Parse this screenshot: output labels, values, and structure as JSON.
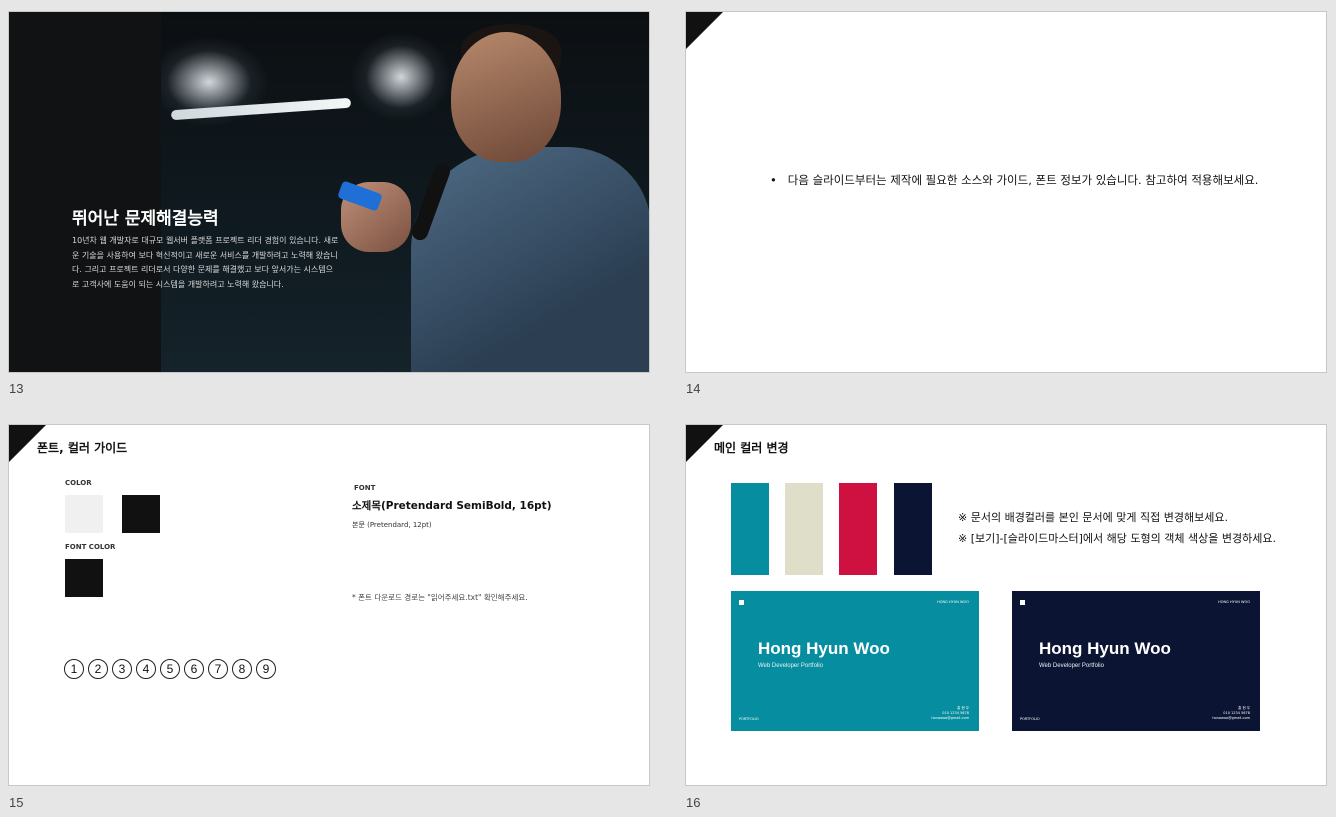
{
  "slides": [
    {
      "number": "13",
      "title": "뛰어난 문제해결능력",
      "body": "10년차 웹 개발자로 대규모 웹서버 플랫폼 프로젝트 리더 경험이 있습니다. 새로운 기술을 사용하여 보다 혁신적이고 새로운 서비스를 개발하려고 노력해 왔습니다. 그리고 프로젝트 리더로서 다양한 문제를 해결했고 보다 앞서가는 시스템으로 고객사에 도움이 되는 시스템을 개발하려고 노력해 왔습니다."
    },
    {
      "number": "14",
      "bullet": "다음 슬라이드부터는 제작에  필요한 소스와 가이드, 폰트 정보가 있습니다. 참고하여 적용해보세요."
    },
    {
      "number": "15",
      "title": "폰트, 컬러 가이드",
      "color_label": "COLOR",
      "font_color_label": "FONT COLOR",
      "font_label": "FONT",
      "font_title": "소제목(Pretendard SemiBold, 16pt)",
      "font_body": "본문 (Pretendard, 12pt)",
      "font_note": "* 폰트 다운로드 경로는 \"읽어주세요.txt\" 확인해주세요.",
      "colors": [
        "#f0f0f0",
        "#111111"
      ],
      "font_colors": [
        "#111111"
      ],
      "numbers": [
        "1",
        "2",
        "3",
        "4",
        "5",
        "6",
        "7",
        "8",
        "9"
      ]
    },
    {
      "number": "16",
      "title": "메인 컬러 변경",
      "palette": [
        "#078da0",
        "#dfdfc9",
        "#cf1142",
        "#0b1433"
      ],
      "note1": "※ 문서의 배경컬러를 본인 문서에 맞게 직접 변경해보세요.",
      "note2": "※ [보기]-[슬라이드마스터]에서 해당 도형의 객체 색상을 변경하세요.",
      "cards": [
        {
          "color": "#078da0",
          "name": "Hong Hyun Woo",
          "subtitle": "Web Developer Portfolio",
          "top_label": "HONG HYUN WOO",
          "footer_left": "PORTFOLIO",
          "footer_right_1": "홍 현 우",
          "footer_right_2": "010 1234 5678",
          "footer_right_3": "honawoo@gmail.com"
        },
        {
          "color": "#0b1433",
          "name": "Hong Hyun Woo",
          "subtitle": "Web Developer Portfolio",
          "top_label": "HONG HYUN WOO",
          "footer_left": "PORTFOLIO",
          "footer_right_1": "홍 현 우",
          "footer_right_2": "010 1234 5678",
          "footer_right_3": "honawoo@gmail.com"
        }
      ]
    }
  ]
}
